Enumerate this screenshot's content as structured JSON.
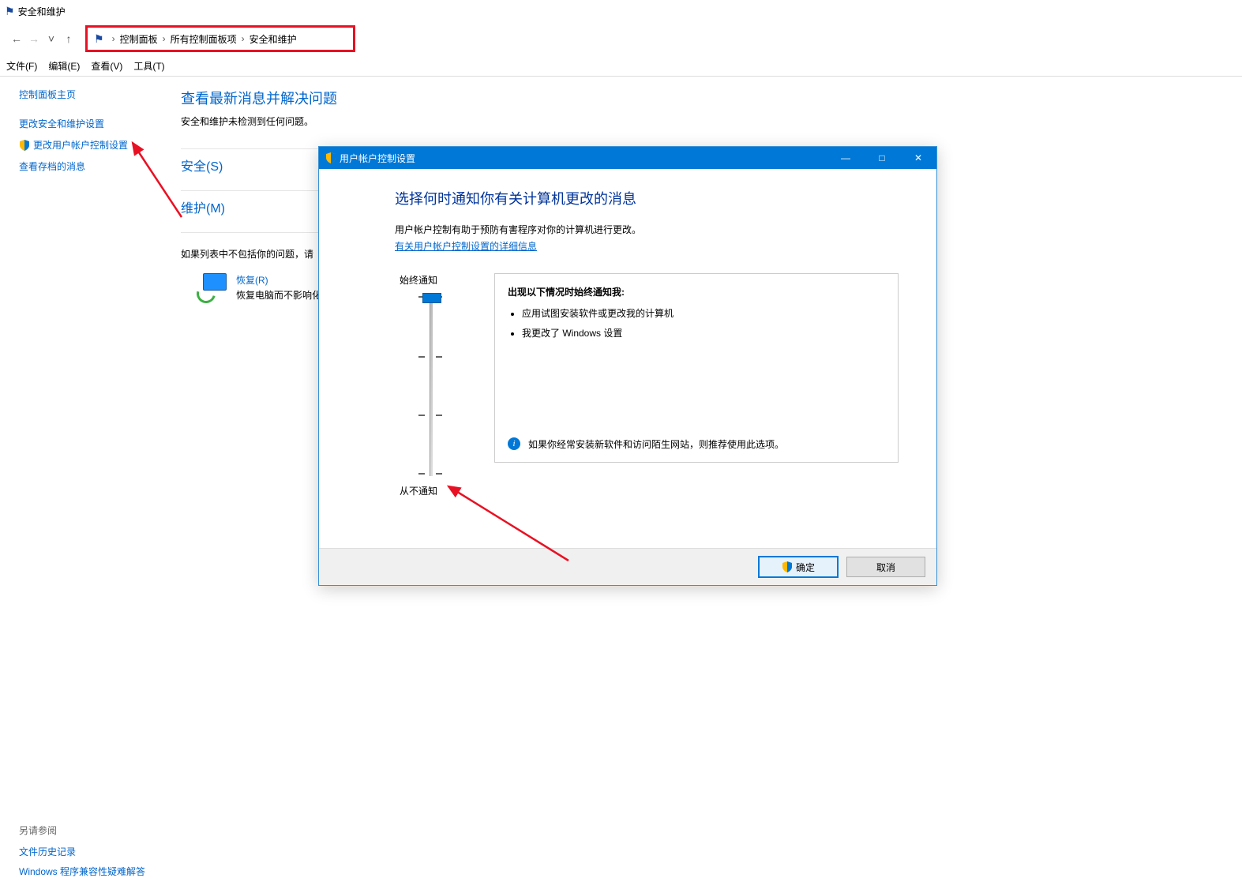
{
  "window": {
    "title": "安全和维护"
  },
  "breadcrumb": {
    "root": "控制面板",
    "mid": "所有控制面板项",
    "leaf": "安全和维护"
  },
  "menu": {
    "file": "文件(F)",
    "edit": "编辑(E)",
    "view": "查看(V)",
    "tools": "工具(T)"
  },
  "sidebar": {
    "home": "控制面板主页",
    "change_sec": "更改安全和维护设置",
    "change_uac": "更改用户帐户控制设置",
    "archived": "查看存档的消息",
    "seealso_hdr": "另请参阅",
    "seealso1": "文件历史记录",
    "seealso2": "Windows 程序兼容性疑难解答"
  },
  "content": {
    "heading": "查看最新消息并解决问题",
    "sub": "安全和维护未检测到任何问题。",
    "sec_header": "安全(S)",
    "maint_header": "维护(M)",
    "notfound": "如果列表中不包括你的问题，请",
    "recover_link": "恢复(R)",
    "recover_desc": "恢复电脑而不影响化电脑并重新开始"
  },
  "dialog": {
    "title": "用户帐户控制设置",
    "heading": "选择何时通知你有关计算机更改的消息",
    "desc": "用户帐户控制有助于预防有害程序对你的计算机进行更改。",
    "more": "有关用户帐户控制设置的详细信息",
    "top": "始终通知",
    "bottom": "从不通知",
    "box_title": "出现以下情况时始终通知我:",
    "bullet1": "应用试图安装软件或更改我的计算机",
    "bullet2": "我更改了 Windows 设置",
    "note": "如果你经常安装新软件和访问陌生网站，则推荐使用此选项。",
    "ok": "确定",
    "cancel": "取消"
  }
}
